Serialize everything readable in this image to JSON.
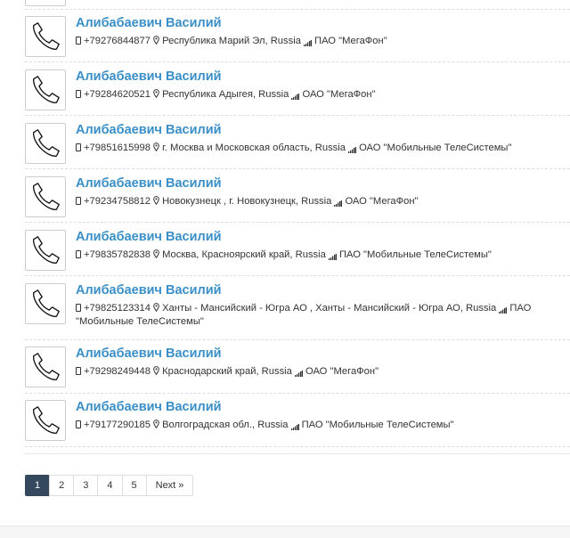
{
  "contacts": [
    {
      "name": "Алибабаевич Василий",
      "phone": "+79276844877",
      "region": "Республика Марий Эл, Russia",
      "operator": "ПАО \"МегаФон\""
    },
    {
      "name": "Алибабаевич Василий",
      "phone": "+79284620521",
      "region": "Республика Адыгея, Russia",
      "operator": "ОАО \"МегаФон\""
    },
    {
      "name": "Алибабаевич Василий",
      "phone": "+79851615998",
      "region": "г. Москва и Московская область, Russia",
      "operator": "ОАО \"Мобильные ТелеСистемы\""
    },
    {
      "name": "Алибабаевич Василий",
      "phone": "+79234758812",
      "region": "Новокузнецк , г. Новокузнецк, Russia",
      "operator": "ОАО \"МегаФон\""
    },
    {
      "name": "Алибабаевич Василий",
      "phone": "+79835782838",
      "region": "Москва, Красноярский край, Russia",
      "operator": "ПАО \"Мобильные ТелеСистемы\""
    },
    {
      "name": "Алибабаевич Василий",
      "phone": "+79825123314",
      "region": "Ханты - Мансийский - Югра АО , Ханты - Мансийский - Югра АО, Russia",
      "operator": "ПАО \"Мобильные ТелеСистемы\""
    },
    {
      "name": "Алибабаевич Василий",
      "phone": "+79298249448",
      "region": "Краснодарский край, Russia",
      "operator": "ОАО \"МегаФон\""
    },
    {
      "name": "Алибабаевич Василий",
      "phone": "+79177290185",
      "region": "Волгоградская обл., Russia",
      "operator": "ПАО \"Мобильные ТелеСистемы\""
    }
  ],
  "pagination": {
    "pages": [
      "1",
      "2",
      "3",
      "4",
      "5"
    ],
    "active": "1",
    "next_label": "Next »"
  },
  "icons": {
    "thumbnail": "phone-handset-icon",
    "phone": "mobile-icon",
    "location": "map-marker-icon",
    "operator": "signal-icon"
  },
  "colors": {
    "name_link": "#3a8fc8",
    "active_page": "#34495e"
  }
}
